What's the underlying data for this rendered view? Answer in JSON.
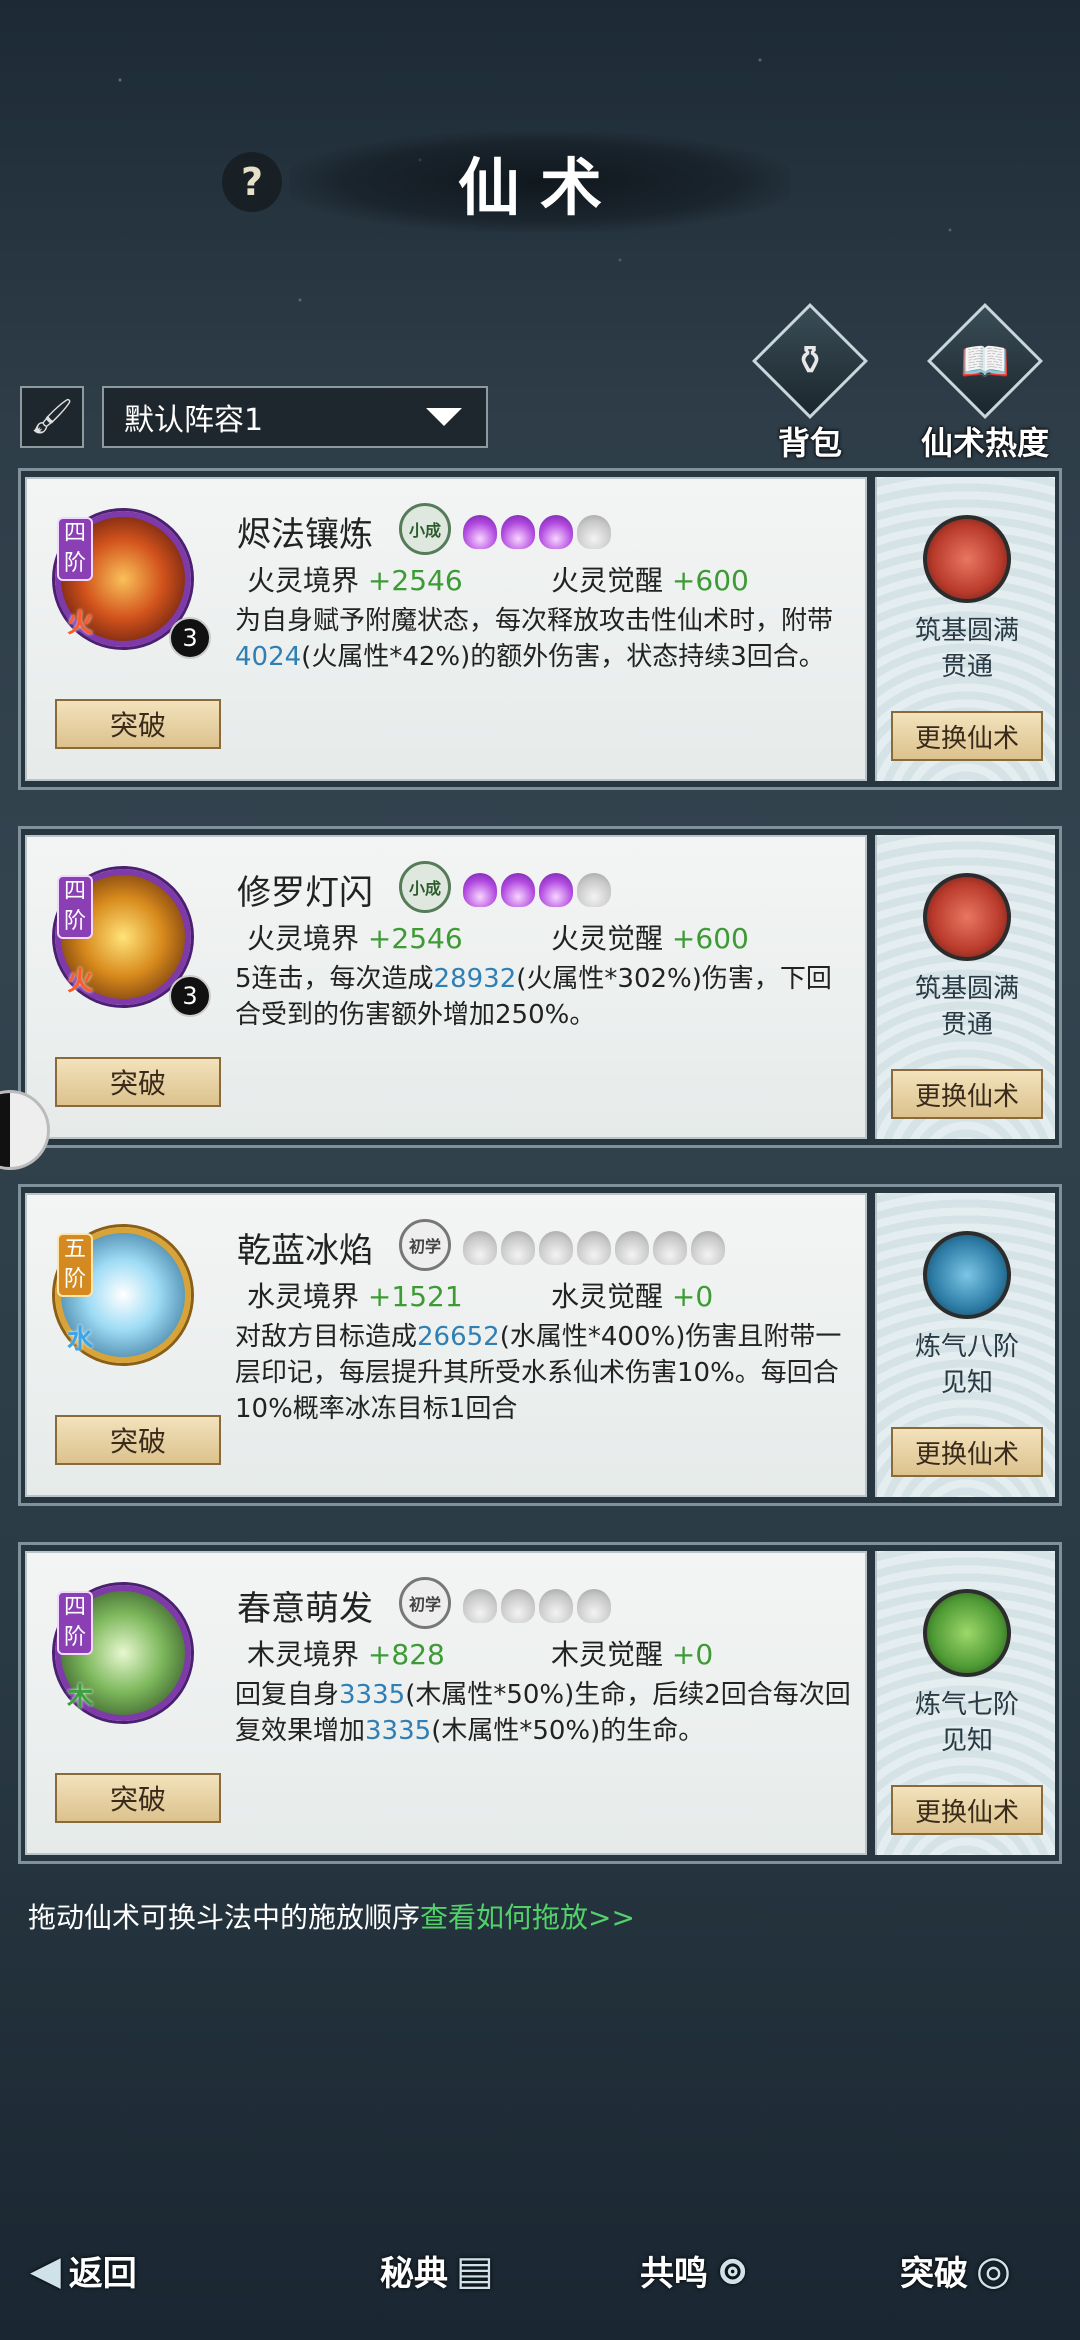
{
  "header": {
    "title": "仙术",
    "help": "?"
  },
  "top_icons": [
    {
      "label": "背包",
      "icon": "bag-icon",
      "glyph": "⚱"
    },
    {
      "label": "仙术热度",
      "icon": "flame-book-icon",
      "glyph": "📖"
    }
  ],
  "toolbar": {
    "brush": "🖌",
    "formation": "默认阵容1"
  },
  "cards": [
    {
      "tier": "四阶",
      "element": "火",
      "level": "3",
      "name": "烬法镶炼",
      "rank_badge": "小成",
      "stat1_label": "火灵境界",
      "stat1_value": "+2546",
      "stat2_label": "火灵觉醒",
      "stat2_value": "+600",
      "desc_a": "为自身赋予附魔状态，每次释放攻击性仙术时，附带",
      "desc_num": "4024",
      "desc_b": "(火属性*42%)的额外伤害，状态持续3回合。",
      "break_label": "突破",
      "seal_text1": "筑基圆满",
      "seal_text2": "贯通",
      "swap_label": "更换仙术"
    },
    {
      "tier": "四阶",
      "element": "火",
      "level": "3",
      "name": "修罗灯闪",
      "rank_badge": "小成",
      "stat1_label": "火灵境界",
      "stat1_value": "+2546",
      "stat2_label": "火灵觉醒",
      "stat2_value": "+600",
      "desc_a": "5连击，每次造成",
      "desc_num": "28932",
      "desc_b": "(火属性*302%)伤害，下回合受到的伤害额外增加250%。",
      "break_label": "突破",
      "seal_text1": "筑基圆满",
      "seal_text2": "贯通",
      "swap_label": "更换仙术"
    },
    {
      "tier": "五阶",
      "element": "水",
      "level": "",
      "name": "乾蓝冰焰",
      "rank_badge": "初学",
      "stat1_label": "水灵境界",
      "stat1_value": "+1521",
      "stat2_label": "水灵觉醒",
      "stat2_value": "+0",
      "desc_a": "对敌方目标造成",
      "desc_num": "26652",
      "desc_b": "(水属性*400%)伤害且附带一层印记，每层提升其所受水系仙术伤害10%。每回合10%概率冰冻目标1回合",
      "break_label": "突破",
      "seal_text1": "炼气八阶",
      "seal_text2": "见知",
      "swap_label": "更换仙术"
    },
    {
      "tier": "四阶",
      "element": "木",
      "level": "",
      "name": "春意萌发",
      "rank_badge": "初学",
      "stat1_label": "木灵境界",
      "stat1_value": "+828",
      "stat2_label": "木灵觉醒",
      "stat2_value": "+0",
      "desc_a": "回复自身",
      "desc_num": "3335",
      "desc_b": "(木属性*50%)生命，后续2回合每次回复效果增加",
      "desc_num2": "3335",
      "desc_c": "(木属性*50%)的生命。",
      "break_label": "突破",
      "seal_text1": "炼气七阶",
      "seal_text2": "见知",
      "swap_label": "更换仙术"
    }
  ],
  "hint": {
    "text": "拖动仙术可换斗法中的施放顺序",
    "link": "查看如何拖放>>"
  },
  "bottom_nav": [
    {
      "label": "返回",
      "icon": "back-arrow-icon"
    },
    {
      "label": "秘典",
      "icon": "book-icon"
    },
    {
      "label": "共鸣",
      "icon": "swirl-icon"
    },
    {
      "label": "突破",
      "icon": "spiral-icon"
    }
  ],
  "colors": {
    "stat_green": "#3d9a35",
    "number_blue": "#2f7fb5",
    "link_green": "#52d16a"
  }
}
